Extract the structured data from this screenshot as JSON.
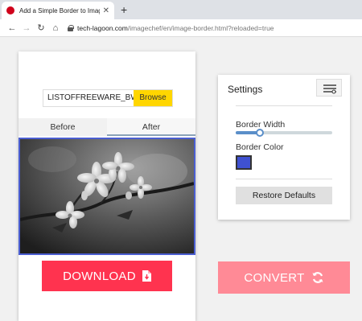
{
  "browser": {
    "tab_title": "Add a Simple Border to Image |",
    "url_host": "tech-lagoon.com",
    "url_path": "/imagechef/en/image-border.html?reloaded=true"
  },
  "editor": {
    "file_name": "LISTOFFREEWARE_BW.JPG",
    "browse_label": "Browse",
    "tabs": [
      {
        "label": "Before"
      },
      {
        "label": "After"
      }
    ],
    "active_tab": "After",
    "download_label": "DOWNLOAD"
  },
  "settings": {
    "title": "Settings",
    "border_width_label": "Border Width",
    "border_width_level": 0.25,
    "border_color_label": "Border Color",
    "border_color": "#3f51d1",
    "restore_label": "Restore Defaults"
  },
  "convert_label": "CONVERT",
  "colors": {
    "download": "#ff334f",
    "convert": "#ff8a96",
    "browse": "#ffd600",
    "preview_border": "#4b5ed1"
  },
  "icons": [
    "close-icon",
    "plus-icon",
    "back-arrow-icon",
    "forward-arrow-icon",
    "reload-icon",
    "home-icon",
    "lock-icon",
    "menu-icon",
    "pdf-file-icon",
    "sync-icon"
  ]
}
